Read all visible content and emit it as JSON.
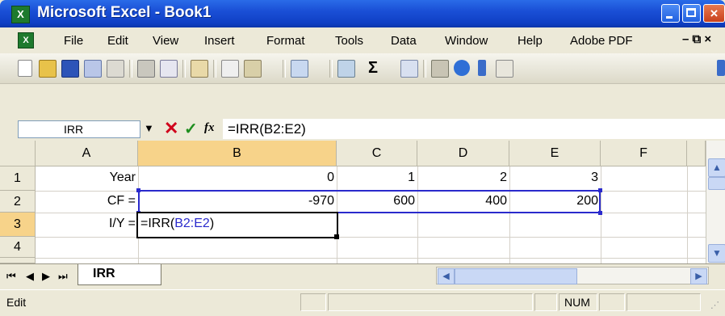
{
  "window": {
    "title": "Microsoft Excel - Book1",
    "app_icon": "excel-icon",
    "close_glyph": "×"
  },
  "menu": {
    "app_icon": "excel-icon",
    "items": [
      "File",
      "Edit",
      "View",
      "Insert",
      "Format",
      "Tools",
      "Data",
      "Window",
      "Help",
      "Adobe PDF"
    ],
    "controls": "–  ⧉  ×"
  },
  "toolbar": {
    "buttons": [
      "new-icon",
      "open-icon",
      "save-icon",
      "permission-icon",
      "email-icon",
      "print-icon",
      "print-preview-icon",
      "research-icon",
      "copy-icon",
      "paste-icon",
      "undo-icon",
      "hyperlink-icon",
      "autosum-icon",
      "sort-ascending-icon",
      "chart-wizard-icon",
      "help-icon",
      "toolbar-options-icon",
      "align-icon"
    ]
  },
  "formula_bar": {
    "name_box": "IRR",
    "cancel_glyph": "✕",
    "enter_glyph": "✓",
    "fx_label": "fx",
    "formula": "=IRR(B2:E2)"
  },
  "sheet": {
    "columns": [
      "A",
      "B",
      "C",
      "D",
      "E",
      "F"
    ],
    "rows": [
      "1",
      "2",
      "3",
      "4"
    ],
    "cells": {
      "A1": "Year",
      "B1": "0",
      "C1": "1",
      "D1": "2",
      "E1": "3",
      "A2": "CF =",
      "B2": "-970",
      "C2": "600",
      "D2": "400",
      "E2": "200",
      "A3": "I/Y =",
      "B3_prefix": "=IRR(",
      "B3_ref": "B2:E2",
      "B3_suffix": ")"
    },
    "active_cell": "B3",
    "range_highlight_color": "#0000FF"
  },
  "tabs": {
    "active": "IRR",
    "nav": [
      "first-sheet-icon",
      "prev-sheet-icon",
      "next-sheet-icon",
      "last-sheet-icon"
    ]
  },
  "status": {
    "mode": "Edit",
    "indicator": "NUM"
  }
}
